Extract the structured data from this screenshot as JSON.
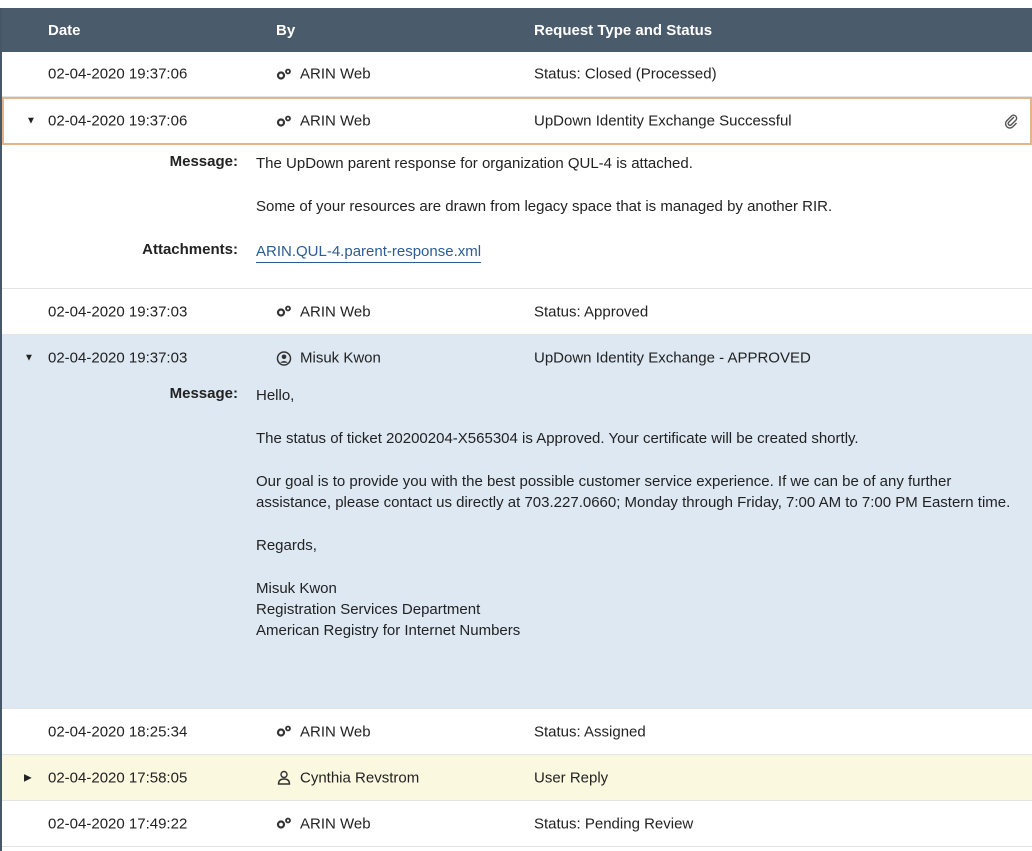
{
  "columns": {
    "date": "Date",
    "by": "By",
    "type": "Request Type and Status"
  },
  "rows": [
    {
      "date": "02-04-2020 19:37:06",
      "by": "ARIN Web",
      "type": "Status: Closed (Processed)"
    },
    {
      "date": "02-04-2020 19:37:06",
      "by": "ARIN Web",
      "type": "UpDown Identity Exchange Successful"
    },
    {
      "date": "02-04-2020 19:37:03",
      "by": "ARIN Web",
      "type": "Status: Approved"
    },
    {
      "date": "02-04-2020 19:37:03",
      "by": "Misuk Kwon",
      "type": "UpDown Identity Exchange - APPROVED"
    },
    {
      "date": "02-04-2020 18:25:34",
      "by": "ARIN Web",
      "type": "Status: Assigned"
    },
    {
      "date": "02-04-2020 17:58:05",
      "by": "Cynthia Revstrom",
      "type": "User Reply"
    },
    {
      "date": "02-04-2020 17:49:22",
      "by": "ARIN Web",
      "type": "Status: Pending Review"
    }
  ],
  "detail1": {
    "message_label": "Message:",
    "message_p1": "The UpDown parent response for organization QUL-4 is attached.",
    "message_p2": "Some of your resources are drawn from legacy space that is managed by another RIR.",
    "attachments_label": "Attachments:",
    "attachment": "ARIN.QUL-4.parent-response.xml"
  },
  "detail2": {
    "message_label": "Message:",
    "p1": "Hello,",
    "p2": "The status of ticket 20200204-X565304 is Approved. Your certificate will be created shortly.",
    "p3": "Our goal is to provide you with the best possible customer service experience. If we can be of any further assistance, please contact us directly at 703.227.0660; Monday through Friday, 7:00 AM to 7:00 PM Eastern time.",
    "p4": "Regards,",
    "sig1": "Misuk Kwon",
    "sig2": "Registration Services Department",
    "sig3": "American Registry for Internet Numbers"
  },
  "icons": {
    "system": "gears-icon",
    "staff": "user-circle-icon",
    "user": "user-outline-icon",
    "attachment": "paperclip-icon",
    "expanded": "caret-down-icon",
    "collapsed": "caret-right-icon"
  },
  "colors": {
    "header_bg": "#4a5b6b",
    "selected_border": "#e5b48a",
    "expanded_bg": "#dde8f3",
    "user_reply_bg": "#fbf8e0",
    "link": "#2a5d94"
  }
}
